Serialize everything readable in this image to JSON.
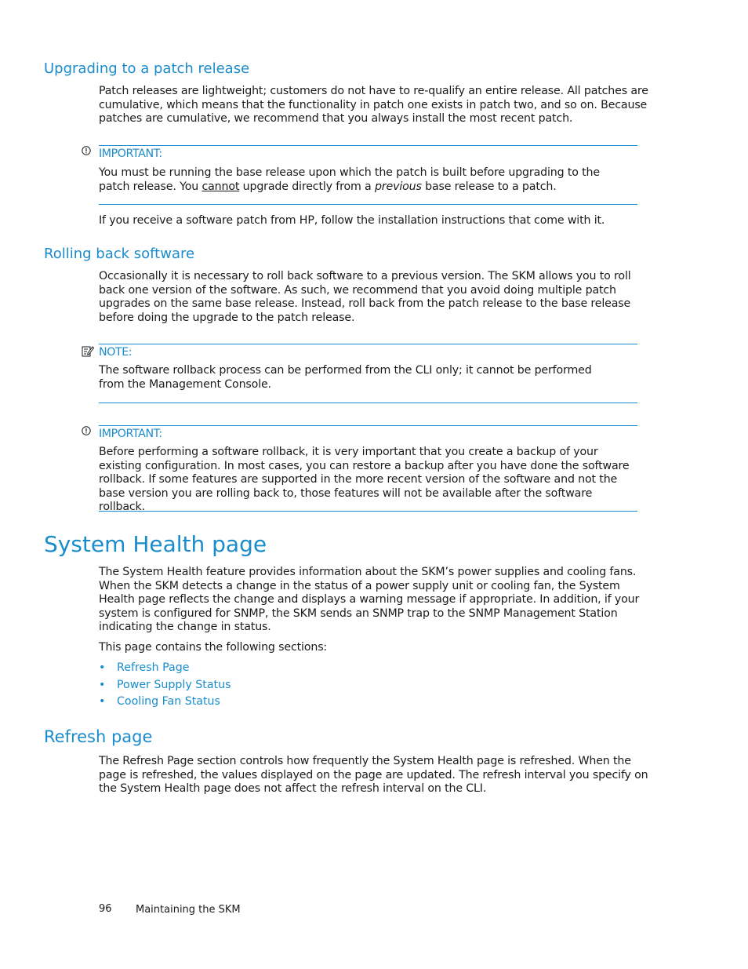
{
  "sections": {
    "upgrading": {
      "heading": "Upgrading to a patch release",
      "paragraph": "Patch releases are lightweight; customers do not have to re-qualify an entire release.  All patches are cumulative, which means that the functionality in patch one exists in patch two, and so on.  Because patches are cumulative, we recommend that you always install the most recent patch.",
      "important": {
        "title": "IMPORTANT:",
        "text_before": "You must be running the base release upon which the patch is built before upgrading to the patch release.  You ",
        "underlined": "cannot",
        "text_middle": " upgrade directly from a ",
        "italic": "previous",
        "text_after": " base release to a patch."
      },
      "after_paragraph": "If you receive a software patch from HP, follow the installation instructions that come with it."
    },
    "rolling_back": {
      "heading": "Rolling back software",
      "paragraph": "Occasionally it is necessary to roll back software to a previous version.  The SKM allows you to roll back one version of the software.  As such, we recommend that you avoid doing multiple patch upgrades on the same base release.  Instead, roll back from the patch release to the base release before doing the upgrade to the patch release.",
      "note": {
        "title": "NOTE:",
        "text": "The software rollback process can be performed from the CLI only; it cannot be performed from the Management Console."
      },
      "important": {
        "title": "IMPORTANT:",
        "text": "Before performing a software rollback, it is very important that you create a backup of your existing configuration.  In most cases, you can restore a backup after you have done the software rollback.  If some features are supported in the more recent version of the software and not the base version you are rolling back to, those features will not be available after the software rollback."
      }
    },
    "system_health": {
      "heading": "System Health page",
      "paragraph": "The System Health feature provides information about the SKM’s power supplies and cooling fans.  When the SKM detects a change in the status of a power supply unit or cooling fan, the System Health page reflects the change and displays a warning message if appropriate.  In addition, if your system is configured for SNMP, the SKM sends an SNMP trap to the SNMP Management Station indicating the change in status.",
      "intro": "This page contains the following sections:",
      "links": [
        "Refresh Page",
        "Power Supply Status",
        "Cooling Fan Status"
      ]
    },
    "refresh": {
      "heading": "Refresh page",
      "paragraph": "The Refresh Page section controls how frequently the System Health page is refreshed.  When the page is refreshed, the values displayed on the page are updated.  The refresh interval you specify on the System Health page does not affect the refresh interval on the CLI."
    }
  },
  "footer": {
    "page_number": "96",
    "chapter": "Maintaining the SKM"
  },
  "colors": {
    "accent": "#1a8ccc",
    "text": "#1a1a1a"
  }
}
